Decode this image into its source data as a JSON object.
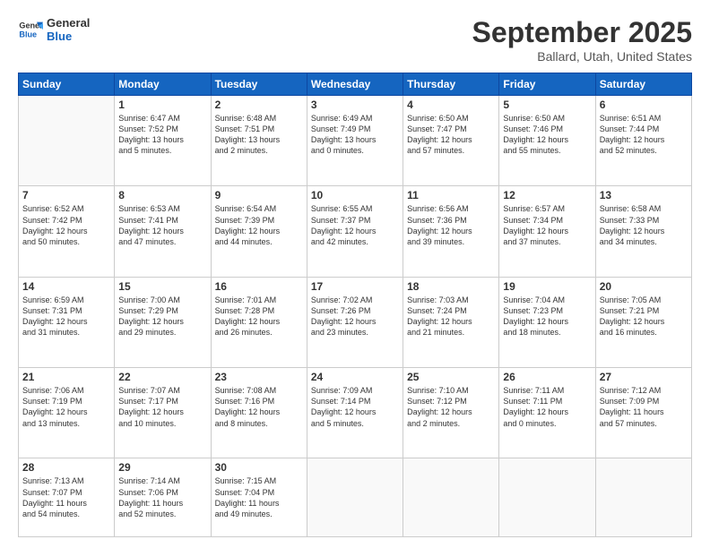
{
  "header": {
    "logo_general": "General",
    "logo_blue": "Blue",
    "month_title": "September 2025",
    "location": "Ballard, Utah, United States"
  },
  "weekdays": [
    "Sunday",
    "Monday",
    "Tuesday",
    "Wednesday",
    "Thursday",
    "Friday",
    "Saturday"
  ],
  "weeks": [
    [
      {
        "day": "",
        "info": ""
      },
      {
        "day": "1",
        "info": "Sunrise: 6:47 AM\nSunset: 7:52 PM\nDaylight: 13 hours\nand 5 minutes."
      },
      {
        "day": "2",
        "info": "Sunrise: 6:48 AM\nSunset: 7:51 PM\nDaylight: 13 hours\nand 2 minutes."
      },
      {
        "day": "3",
        "info": "Sunrise: 6:49 AM\nSunset: 7:49 PM\nDaylight: 13 hours\nand 0 minutes."
      },
      {
        "day": "4",
        "info": "Sunrise: 6:50 AM\nSunset: 7:47 PM\nDaylight: 12 hours\nand 57 minutes."
      },
      {
        "day": "5",
        "info": "Sunrise: 6:50 AM\nSunset: 7:46 PM\nDaylight: 12 hours\nand 55 minutes."
      },
      {
        "day": "6",
        "info": "Sunrise: 6:51 AM\nSunset: 7:44 PM\nDaylight: 12 hours\nand 52 minutes."
      }
    ],
    [
      {
        "day": "7",
        "info": "Sunrise: 6:52 AM\nSunset: 7:42 PM\nDaylight: 12 hours\nand 50 minutes."
      },
      {
        "day": "8",
        "info": "Sunrise: 6:53 AM\nSunset: 7:41 PM\nDaylight: 12 hours\nand 47 minutes."
      },
      {
        "day": "9",
        "info": "Sunrise: 6:54 AM\nSunset: 7:39 PM\nDaylight: 12 hours\nand 44 minutes."
      },
      {
        "day": "10",
        "info": "Sunrise: 6:55 AM\nSunset: 7:37 PM\nDaylight: 12 hours\nand 42 minutes."
      },
      {
        "day": "11",
        "info": "Sunrise: 6:56 AM\nSunset: 7:36 PM\nDaylight: 12 hours\nand 39 minutes."
      },
      {
        "day": "12",
        "info": "Sunrise: 6:57 AM\nSunset: 7:34 PM\nDaylight: 12 hours\nand 37 minutes."
      },
      {
        "day": "13",
        "info": "Sunrise: 6:58 AM\nSunset: 7:33 PM\nDaylight: 12 hours\nand 34 minutes."
      }
    ],
    [
      {
        "day": "14",
        "info": "Sunrise: 6:59 AM\nSunset: 7:31 PM\nDaylight: 12 hours\nand 31 minutes."
      },
      {
        "day": "15",
        "info": "Sunrise: 7:00 AM\nSunset: 7:29 PM\nDaylight: 12 hours\nand 29 minutes."
      },
      {
        "day": "16",
        "info": "Sunrise: 7:01 AM\nSunset: 7:28 PM\nDaylight: 12 hours\nand 26 minutes."
      },
      {
        "day": "17",
        "info": "Sunrise: 7:02 AM\nSunset: 7:26 PM\nDaylight: 12 hours\nand 23 minutes."
      },
      {
        "day": "18",
        "info": "Sunrise: 7:03 AM\nSunset: 7:24 PM\nDaylight: 12 hours\nand 21 minutes."
      },
      {
        "day": "19",
        "info": "Sunrise: 7:04 AM\nSunset: 7:23 PM\nDaylight: 12 hours\nand 18 minutes."
      },
      {
        "day": "20",
        "info": "Sunrise: 7:05 AM\nSunset: 7:21 PM\nDaylight: 12 hours\nand 16 minutes."
      }
    ],
    [
      {
        "day": "21",
        "info": "Sunrise: 7:06 AM\nSunset: 7:19 PM\nDaylight: 12 hours\nand 13 minutes."
      },
      {
        "day": "22",
        "info": "Sunrise: 7:07 AM\nSunset: 7:17 PM\nDaylight: 12 hours\nand 10 minutes."
      },
      {
        "day": "23",
        "info": "Sunrise: 7:08 AM\nSunset: 7:16 PM\nDaylight: 12 hours\nand 8 minutes."
      },
      {
        "day": "24",
        "info": "Sunrise: 7:09 AM\nSunset: 7:14 PM\nDaylight: 12 hours\nand 5 minutes."
      },
      {
        "day": "25",
        "info": "Sunrise: 7:10 AM\nSunset: 7:12 PM\nDaylight: 12 hours\nand 2 minutes."
      },
      {
        "day": "26",
        "info": "Sunrise: 7:11 AM\nSunset: 7:11 PM\nDaylight: 12 hours\nand 0 minutes."
      },
      {
        "day": "27",
        "info": "Sunrise: 7:12 AM\nSunset: 7:09 PM\nDaylight: 11 hours\nand 57 minutes."
      }
    ],
    [
      {
        "day": "28",
        "info": "Sunrise: 7:13 AM\nSunset: 7:07 PM\nDaylight: 11 hours\nand 54 minutes."
      },
      {
        "day": "29",
        "info": "Sunrise: 7:14 AM\nSunset: 7:06 PM\nDaylight: 11 hours\nand 52 minutes."
      },
      {
        "day": "30",
        "info": "Sunrise: 7:15 AM\nSunset: 7:04 PM\nDaylight: 11 hours\nand 49 minutes."
      },
      {
        "day": "",
        "info": ""
      },
      {
        "day": "",
        "info": ""
      },
      {
        "day": "",
        "info": ""
      },
      {
        "day": "",
        "info": ""
      }
    ]
  ]
}
